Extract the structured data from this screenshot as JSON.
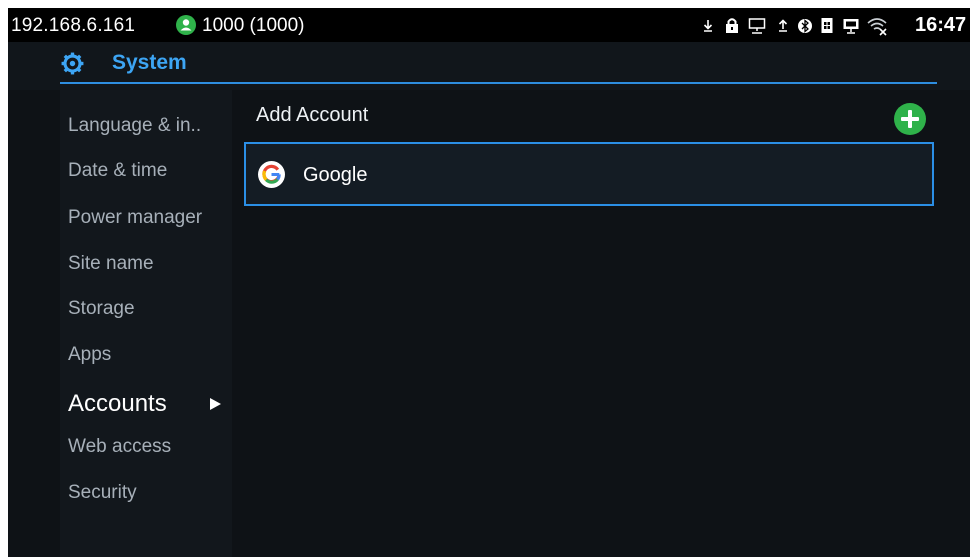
{
  "status_bar": {
    "ip": "192.168.6.161",
    "account_icon": "account-status-icon",
    "account_status": "1000 (1000)",
    "icons": [
      "download-icon",
      "lock-icon",
      "network-icon",
      "upload-icon",
      "bluetooth-icon",
      "sim-icon",
      "monitor-icon",
      "wifi-icon"
    ],
    "time": "16:47"
  },
  "header": {
    "icon": "gear-icon",
    "title": "System",
    "accent_color": "#3da5f4"
  },
  "sidebar": {
    "items": [
      {
        "label": "Language & in.."
      },
      {
        "label": "Date & time"
      },
      {
        "label": "Power manager"
      },
      {
        "label": "Site name"
      },
      {
        "label": "Storage"
      },
      {
        "label": "Apps"
      },
      {
        "label": "Accounts",
        "active": true
      },
      {
        "label": "Web access"
      },
      {
        "label": "Security"
      }
    ]
  },
  "content": {
    "add_account_label": "Add Account",
    "add_icon": "plus-icon",
    "accounts": [
      {
        "label": "Google",
        "icon": "google-icon"
      }
    ]
  }
}
